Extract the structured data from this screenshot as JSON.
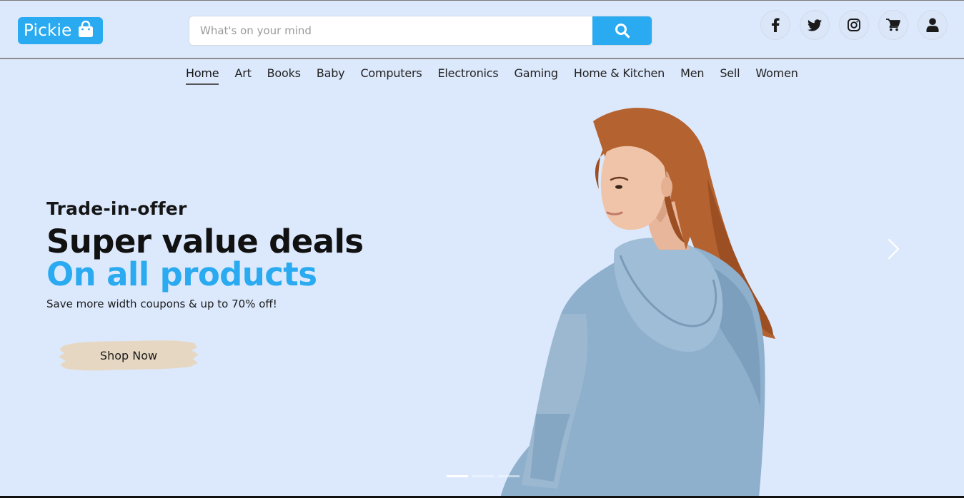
{
  "header": {
    "logo_text": "Pickie",
    "search_placeholder": "What's on your mind",
    "icons": [
      "facebook-icon",
      "twitter-icon",
      "instagram-icon",
      "cart-icon",
      "user-icon"
    ]
  },
  "nav": {
    "items": [
      "Home",
      "Art",
      "Books",
      "Baby",
      "Computers",
      "Electronics",
      "Gaming",
      "Home & Kitchen",
      "Men",
      "Sell",
      "Women"
    ],
    "active": "Home"
  },
  "hero": {
    "subtitle": "Trade-in-offer",
    "title_line1": "Super value deals",
    "title_line2": "On all products",
    "description": "Save more width coupons & up to 70% off!",
    "cta_label": "Shop Now"
  },
  "carousel": {
    "slides": 3,
    "active_slide": 1
  },
  "colors": {
    "accent": "#2aaaf0",
    "background": "#dce9fc",
    "cta_brush": "#e6d7c3",
    "hoodie": "#8eb0cc",
    "hair": "#b4622f"
  }
}
